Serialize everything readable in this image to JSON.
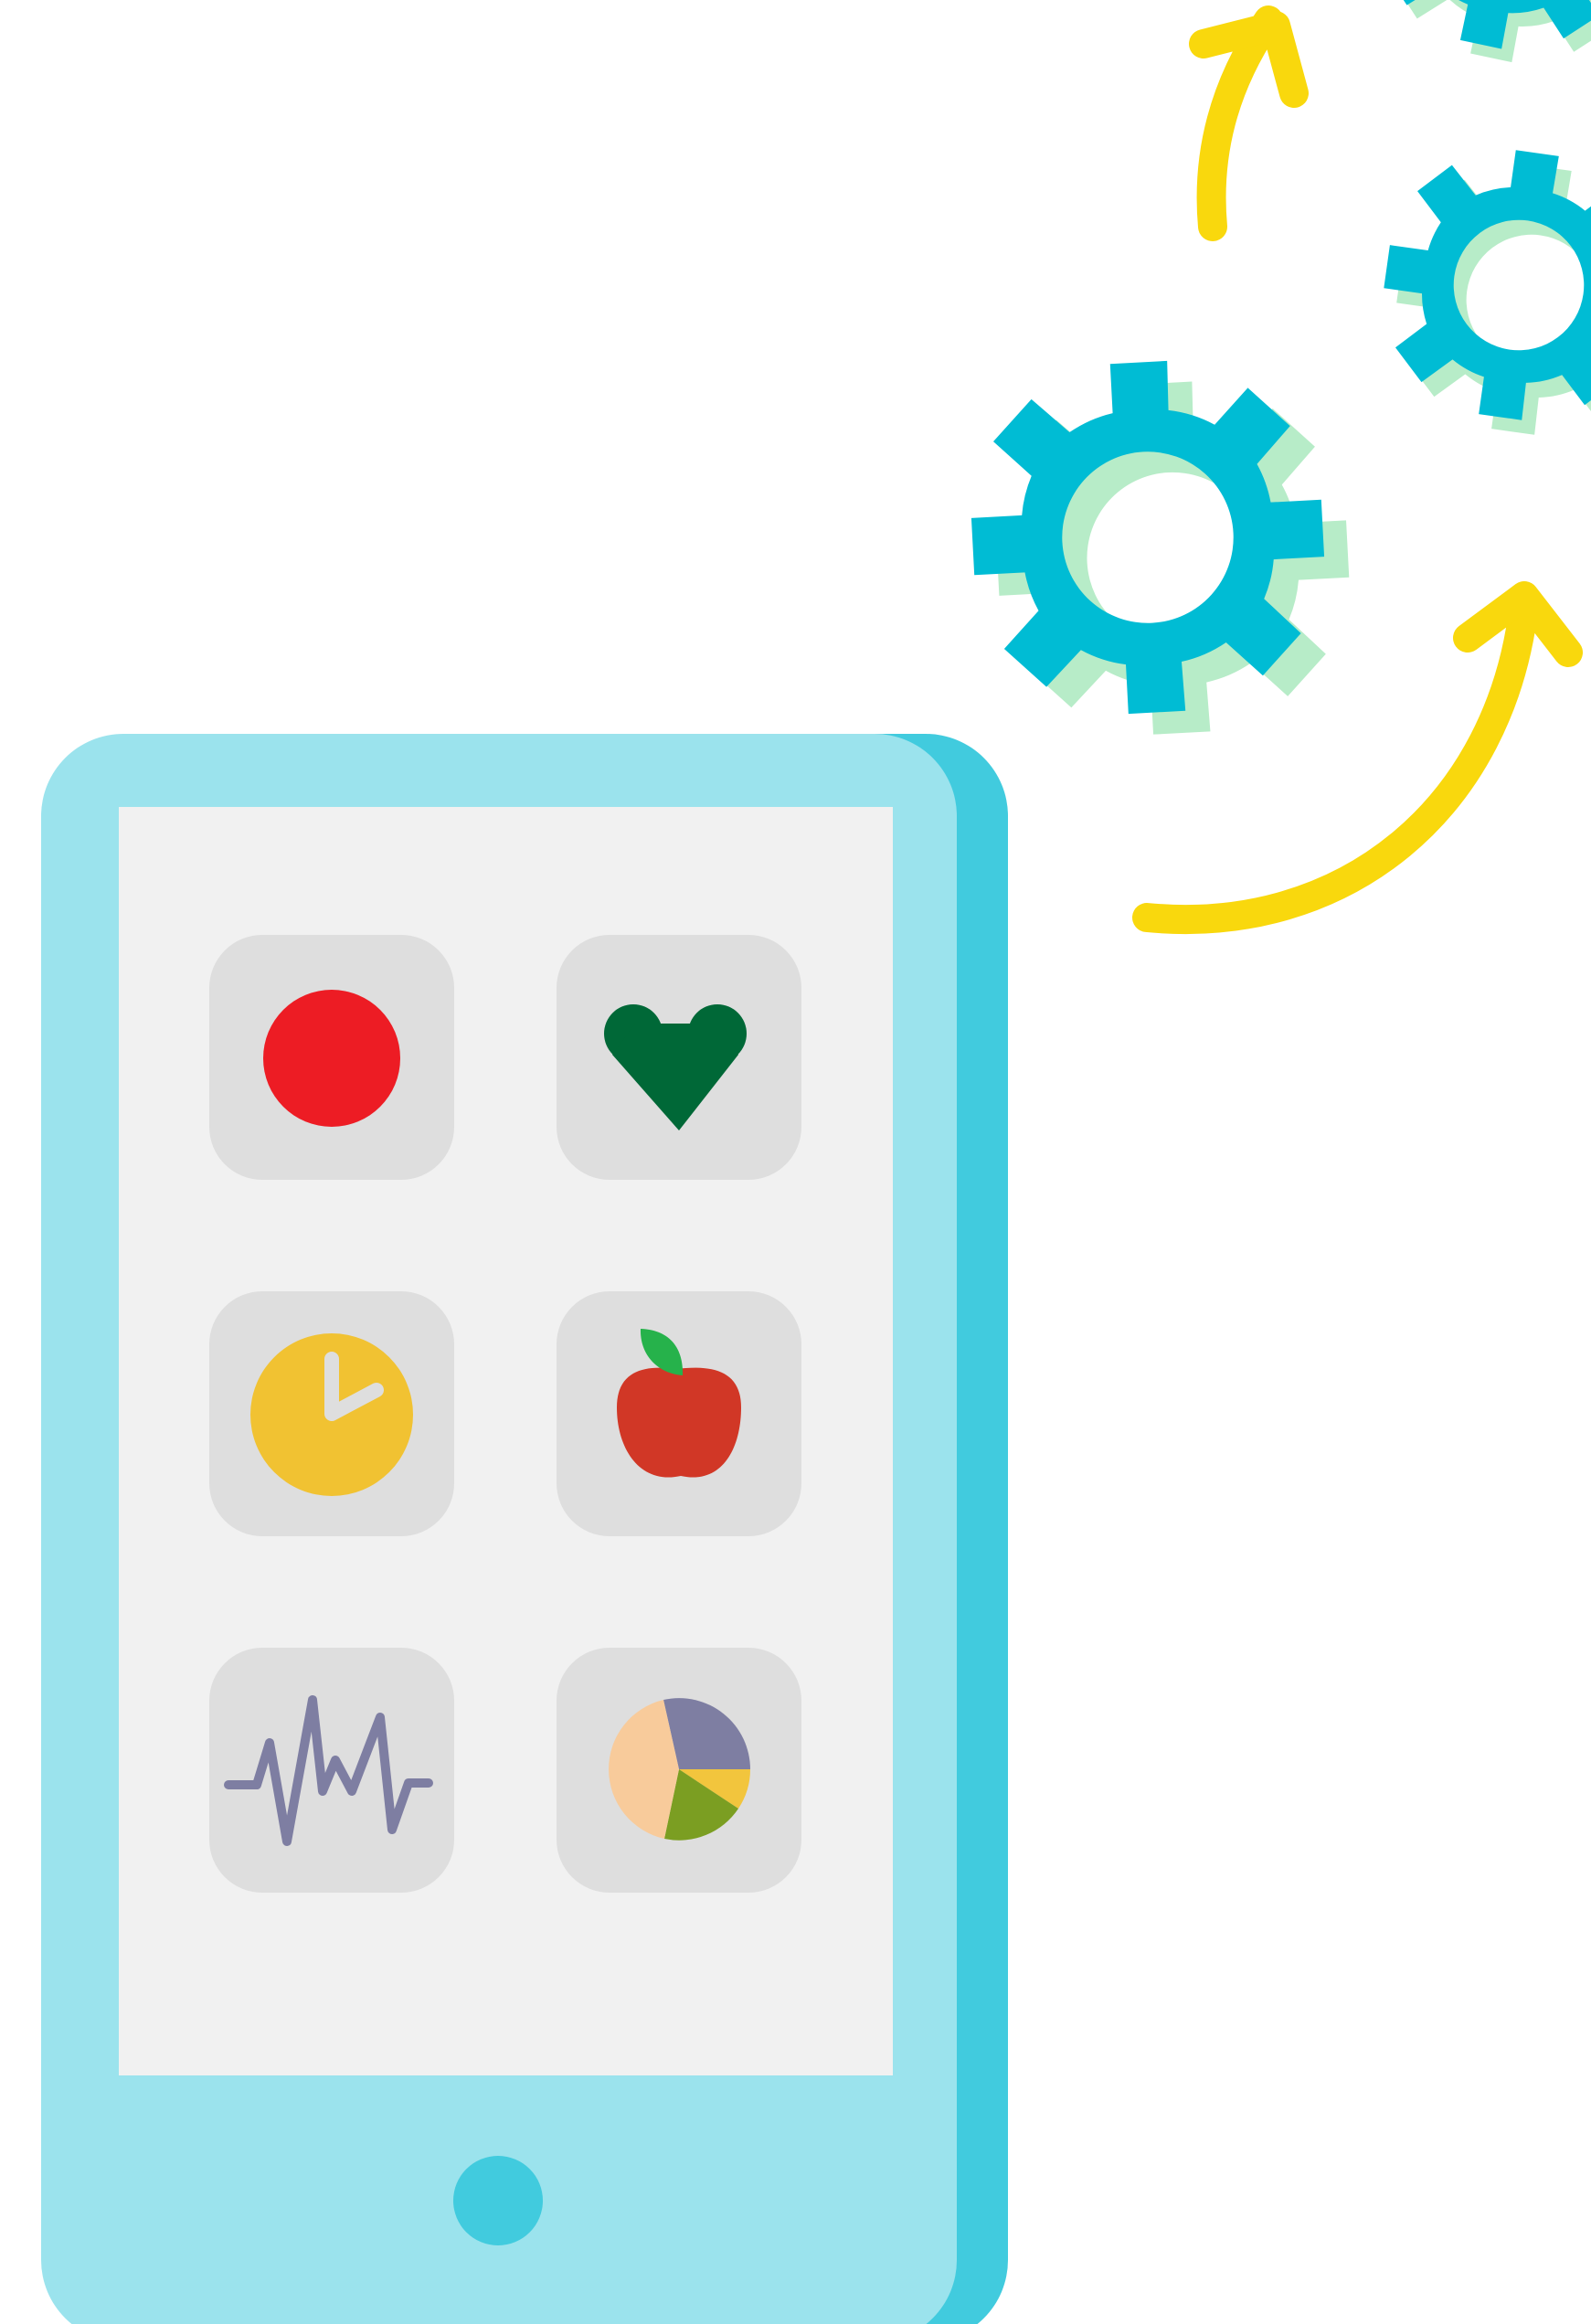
{
  "illustration": {
    "subject": "smartphone-with-app-grid-and-gears",
    "colors": {
      "background": "#ffffff",
      "phone_body_light": "#9be3ed",
      "phone_body_shadow": "#41cbde",
      "screen": "#f1f1f1",
      "app_tile": "#dedede",
      "home_button": "#41cbde",
      "gear": "#00bcd4",
      "gear_shadow": "#b7ecc8",
      "arrow": "#f9d80d"
    },
    "apps": [
      {
        "icon": "record-dot-icon",
        "color": "#ed1c24"
      },
      {
        "icon": "heart-icon",
        "color": "#006837"
      },
      {
        "icon": "clock-icon",
        "color": "#f1c232"
      },
      {
        "icon": "apple-icon",
        "color": "#d13726"
      },
      {
        "icon": "heartbeat-icon",
        "color": "#7e7ea2"
      },
      {
        "icon": "pie-chart-icon",
        "colors": [
          "#7e7ea2",
          "#f2c53d",
          "#7b9e22",
          "#f8cb9b"
        ]
      }
    ],
    "decorations": [
      {
        "icon": "gear-icon",
        "count": 3
      },
      {
        "icon": "curved-arrow-icon",
        "count": 2
      }
    ]
  }
}
